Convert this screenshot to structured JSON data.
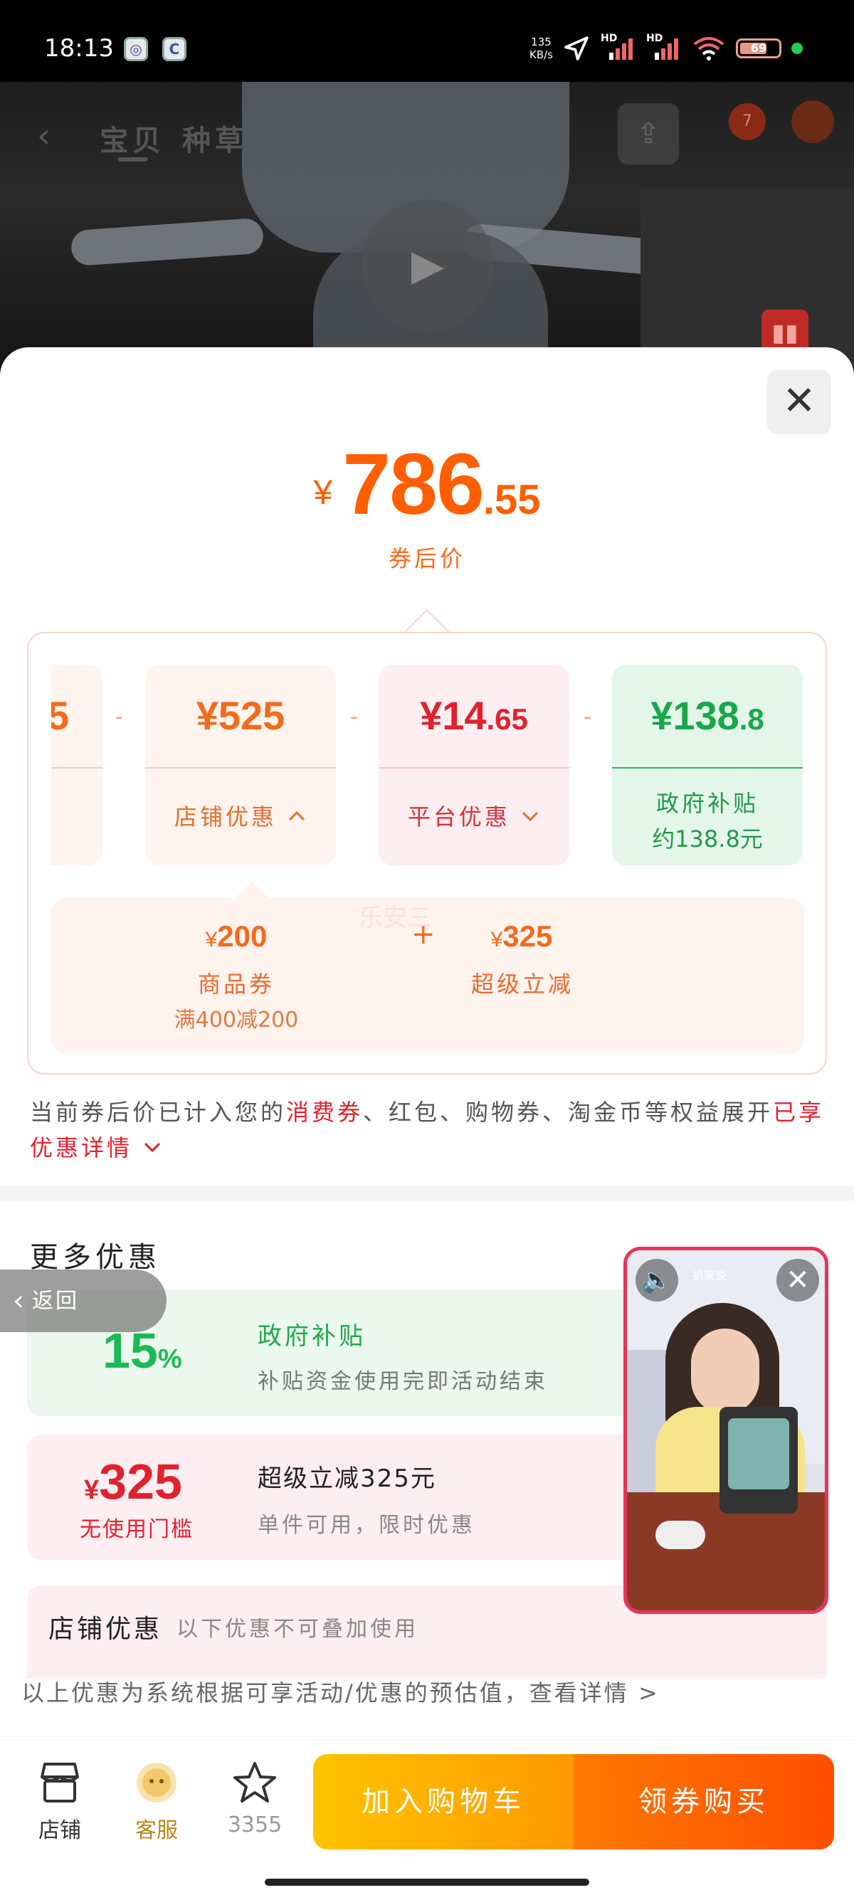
{
  "status_bar": {
    "time": "18:13",
    "net_speed_value": "135",
    "net_speed_unit": "KB/s",
    "signal1": "HD",
    "signal2": "HD",
    "battery": "69"
  },
  "background": {
    "tab_baobei": "宝贝",
    "tab_zhongcao": "种草",
    "notif_count": "7"
  },
  "price": {
    "currency": "¥",
    "integer": "786",
    "decimal": ".55",
    "label": "券后价"
  },
  "breakdown": {
    "cards": [
      {
        "value_main": "¥525",
        "value_dec": "",
        "label": "店铺优惠",
        "arrow": "up"
      },
      {
        "value_main": "¥14",
        "value_dec": ".65",
        "label": "平台优惠",
        "arrow": "down"
      },
      {
        "value_main": "¥138",
        "value_dec": ".8",
        "label": "政府补贴",
        "sub": "约138.8元"
      }
    ],
    "partial_card_text": "5",
    "minus": "-",
    "plus": "+",
    "coupon_items": [
      {
        "currency": "¥",
        "value": "200",
        "name": "商品券",
        "condition": "满400减200"
      },
      {
        "currency": "¥",
        "value": "325",
        "name": "超级立减"
      }
    ],
    "watermark": "乐安三"
  },
  "note": {
    "part1": "当前券后价已计入您的",
    "highlight1": "消费券",
    "part2": "、红包、购物券、淘金币等权益展开",
    "highlight2": "已享优惠详情"
  },
  "more_offers": {
    "title": "更多优惠",
    "back_label": "返回",
    "items": [
      {
        "value": "15",
        "unit": "%",
        "title": "政府补贴",
        "desc": "补贴资金使用完即活动结束"
      },
      {
        "currency": "¥",
        "value": "325",
        "caption": "无使用门槛",
        "title": "超级立减325元",
        "desc": "单件可用，限时优惠"
      },
      {
        "title": "店铺优惠",
        "desc": "以下优惠不可叠加使用"
      }
    ],
    "disclaimer": "以上优惠为系统根据可享活动/优惠的预估值，查看详情 >"
  },
  "floating_video": {
    "logo_text": "扒家说"
  },
  "bottom_bar": {
    "shop_label": "店铺",
    "service_label": "客服",
    "fav_count": "3355",
    "add_cart": "加入购物车",
    "buy": "领券购买"
  },
  "colors": {
    "accent_orange": "#ff5f00",
    "green": "#1db954",
    "red": "#e0222f",
    "cart_gradient": [
      "#ffc400",
      "#ff9a00"
    ],
    "buy_gradient": [
      "#ff7a00",
      "#ff4e00"
    ]
  }
}
